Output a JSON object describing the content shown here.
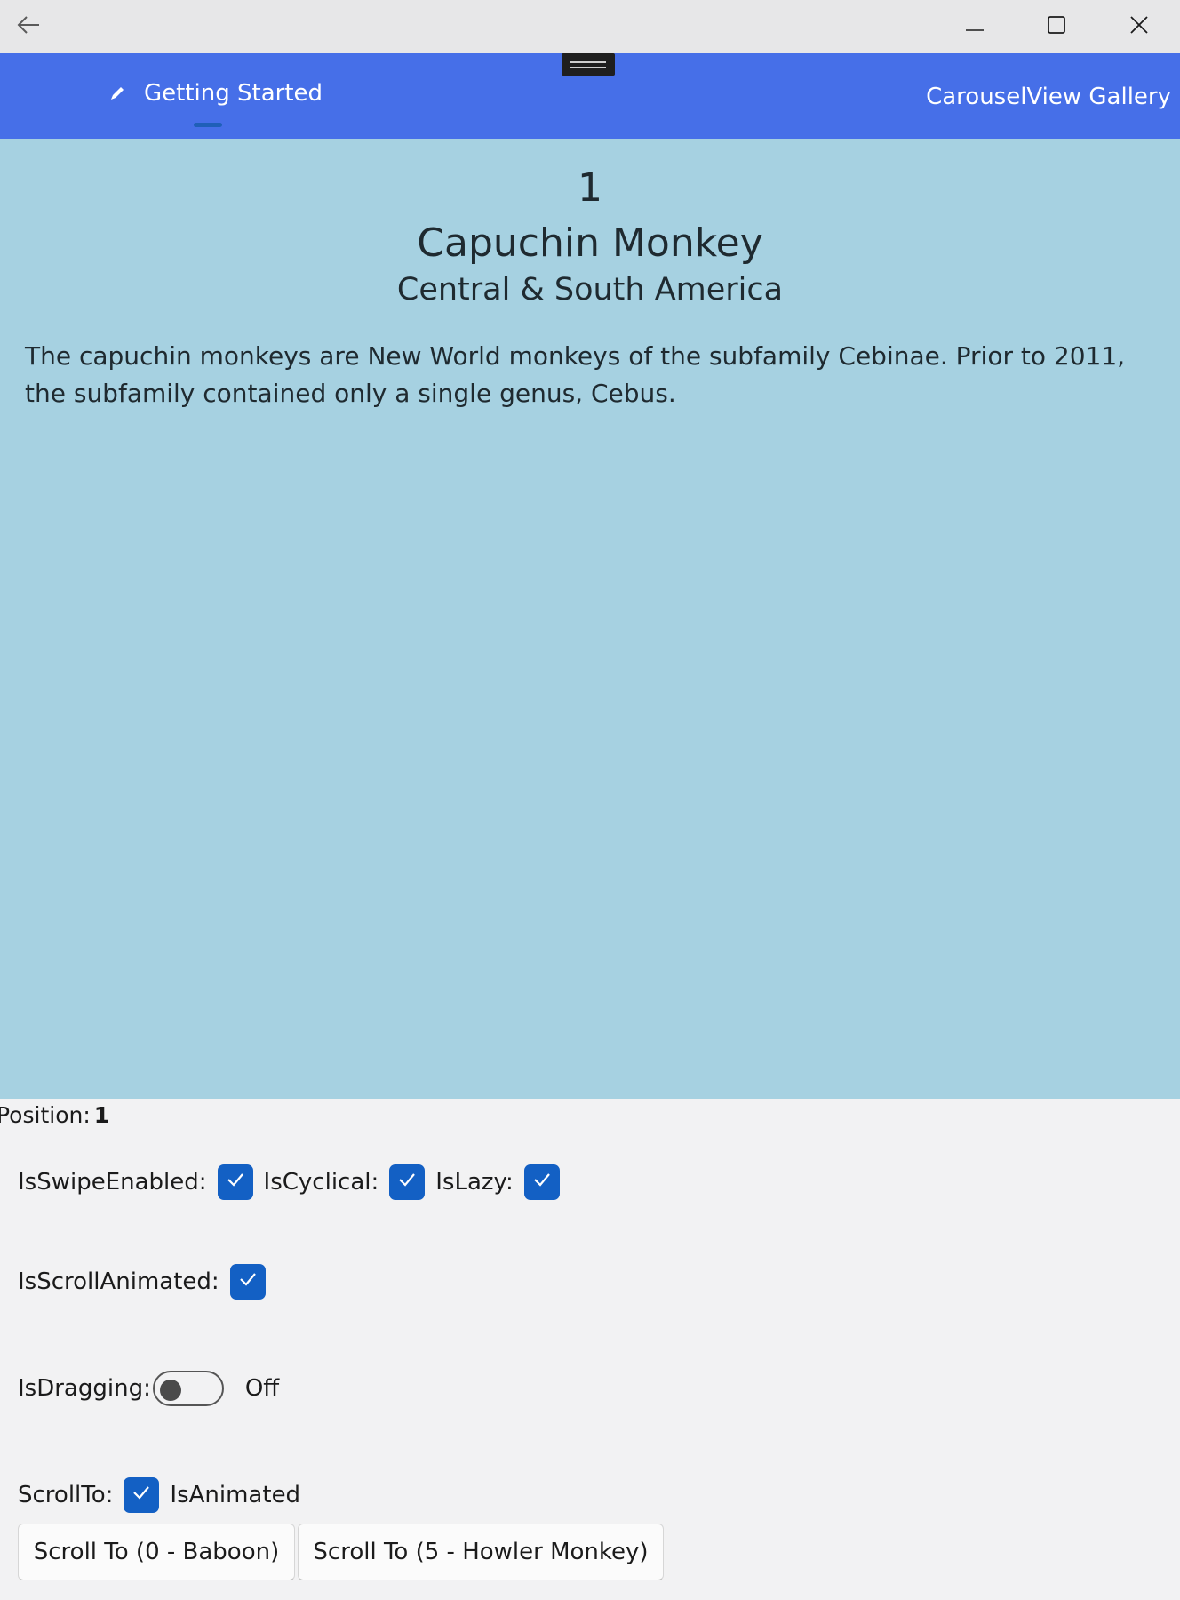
{
  "window": {
    "back_icon": "arrow-left-icon",
    "minimize_icon": "minimize-icon",
    "maximize_icon": "maximize-icon",
    "close_icon": "close-icon"
  },
  "navbar": {
    "tab_label": "Getting Started",
    "tab_icon": "pencil-icon",
    "page_title": "CarouselView Gallery",
    "background_color": "#466fe8"
  },
  "card": {
    "position": "1",
    "name": "Capuchin Monkey",
    "location": "Central & South America",
    "description": "The capuchin monkeys are New World monkeys of the subfamily Cebinae. Prior to 2011, the subfamily contained only a single genus, Cebus.",
    "background_color": "#a6d1e1"
  },
  "controls": {
    "position_label": "Position:",
    "position_value": "1",
    "is_swipe_enabled_label": "IsSwipeEnabled:",
    "is_cyclical_label": "IsCyclical:",
    "is_lazy_label": "IsLazy:",
    "is_scroll_animated_label": "IsScrollAnimated:",
    "is_dragging_label": "IsDragging:",
    "is_dragging_state": "Off",
    "scroll_to_label": "ScrollTo:",
    "is_animated_label": "IsAnimated",
    "checkbox_color": "#1360c4",
    "button_scroll_baboon": "Scroll To (0 - Baboon)",
    "button_scroll_howler": "Scroll To (5 - Howler Monkey)"
  }
}
